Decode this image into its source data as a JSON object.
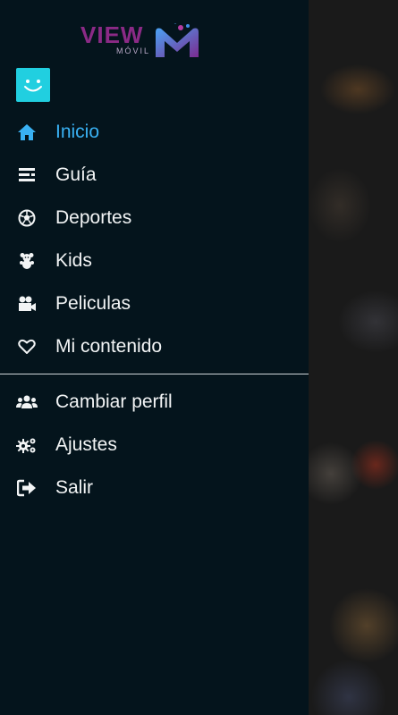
{
  "brand": {
    "word": "VIEW",
    "sub": "MÓVIL",
    "letter": "M",
    "colors": {
      "primary": "#8b2a86",
      "accent": "#39b1f3",
      "avatar": "#21cfe0"
    }
  },
  "avatar": {
    "icon": "smiley-icon"
  },
  "menu": {
    "primary": [
      {
        "label": "Inicio",
        "icon": "home-icon",
        "active": true
      },
      {
        "label": "Guía",
        "icon": "guide-icon"
      },
      {
        "label": "Deportes",
        "icon": "soccer-ball-icon"
      },
      {
        "label": "Kids",
        "icon": "teddy-bear-icon"
      },
      {
        "label": "Peliculas",
        "icon": "film-camera-icon"
      },
      {
        "label": "Mi contenido",
        "icon": "heart-icon"
      }
    ],
    "secondary": [
      {
        "label": "Cambiar perfil",
        "icon": "users-icon"
      },
      {
        "label": "Ajustes",
        "icon": "gears-icon"
      },
      {
        "label": "Salir",
        "icon": "sign-out-icon"
      }
    ]
  }
}
